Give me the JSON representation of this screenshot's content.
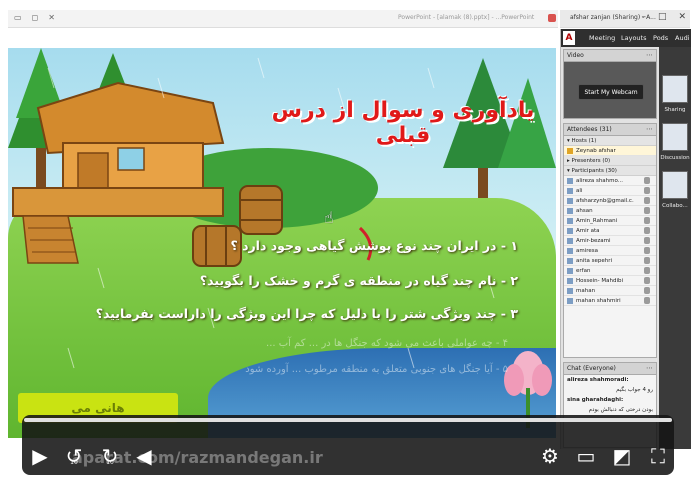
{
  "ppt_window": {
    "title": "PowerPoint - [alamak (8).pptx] - ...PowerPoint"
  },
  "adobe_window": {
    "title": "afshar zanjan (Sharing) - A..."
  },
  "menubar": {
    "logo": "A",
    "meeting": "Meeting",
    "layouts": "Layouts",
    "pods": "Pods",
    "audio": "Audi"
  },
  "layouts": [
    {
      "label": "Sharing"
    },
    {
      "label": "Discussion"
    },
    {
      "label": "Collabo..."
    }
  ],
  "video_pod": {
    "title": "Video",
    "webcam_button": "Start My Webcam"
  },
  "attendees_pod": {
    "title": "Attendees",
    "count": "(31)",
    "hosts_label": "Hosts (1)",
    "host_name": "Zeynab afshar",
    "presenters_label": "Presenters (0)",
    "participants_label": "Participants (30)",
    "participants": [
      "alireza shahmo...",
      "ali",
      "afsharzynb@gmail.c...",
      "ahsan",
      "Amin_Rahmani",
      "Amir ata",
      "Amir-bezami",
      "amiresa",
      "anita sepehri",
      "erfan",
      "Hossein- Mahdibi",
      "mahan",
      "mahan shahmiri"
    ]
  },
  "chat_pod": {
    "title": "Chat",
    "scope": "(Everyone)",
    "messages": [
      {
        "sender": "alireza shahmoradi:",
        "text": "رو 4 جواب بگیم"
      },
      {
        "sender": "sina gharahdaghi:",
        "text": "بودن درختی که دنبالش بودم"
      }
    ]
  },
  "slide": {
    "title": "یادآوری و سوال از درس قبلی",
    "q1": "۱ - در ایران چند نوع پوشش گیاهی وجود دارد ؟",
    "q2": "۲ - نام چند گیاه در منطقه ی گرم و خشک را بگویید؟",
    "q3": "۳ - چند ویژگی شتر را با دلیل که چرا این ویژگی را داراست بفرمایید؟",
    "faded1": "۴ - چه عواملی باعث می شود که جنگل ها در ... کم آب ...",
    "faded2": "۵ - آیا جنگل های جنوبی متعلق به منطقه مرطوب ... آورده شود",
    "yellow_button": "هانی می"
  },
  "player": {
    "watermark": "aparat.com/razmandegan.ir",
    "skip_back_label": "10",
    "skip_fwd_label": "10",
    "progress": 0.0
  },
  "colors": {
    "slide_title": "#e01919",
    "accent_yellow": "#c9e312",
    "panel_bg": "#ececec",
    "menubar_bg": "#2f2f2f"
  }
}
